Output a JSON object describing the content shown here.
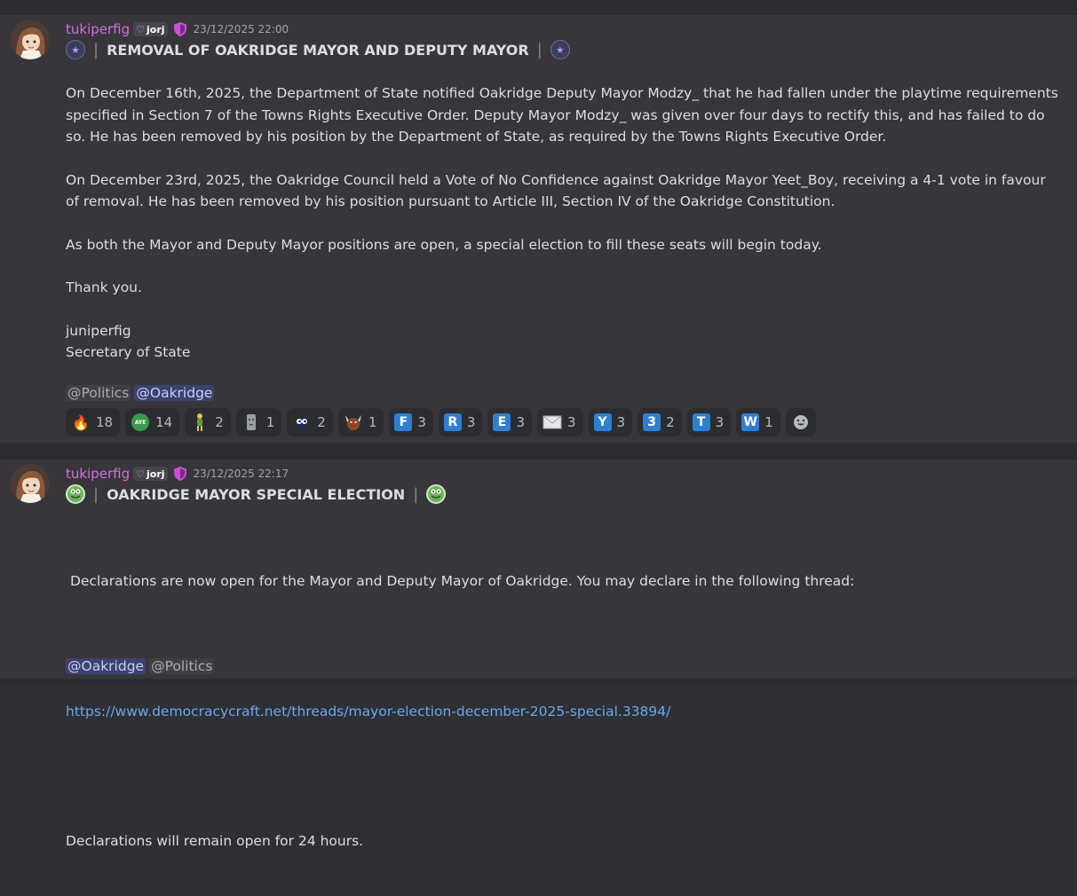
{
  "message1": {
    "username": "tukiperfig",
    "tag": "jorj",
    "timestamp": "23/12/2025 22:00",
    "title": "REMOVAL OF OAKRIDGE MAYOR AND DEPUTY MAYOR",
    "paragraphs": [
      "On December 16th, 2025, the Department of State notified Oakridge Deputy Mayor Modzy_ that he had fallen under the playtime requirements specified in Section 7 of the Towns Rights Executive Order. Deputy Mayor Modzy_ was given over four days to rectify this, and has failed to do so. He has been removed by his position by the Department of State, as required by the Towns Rights Executive Order.",
      "On December 23rd, 2025, the Oakridge Council held a Vote of No Confidence against Oakridge Mayor Yeet_Boy, receiving a 4-1 vote in favour of removal. He has been removed by his position pursuant to Article III, Section IV of the Oakridge Constitution.",
      "As both the Mayor and Deputy Mayor positions are open, a special election to fill these seats will begin today.",
      "Thank you."
    ],
    "signature_name": "juniperfig",
    "signature_title": "Secretary of State",
    "mentions": [
      "@Politics",
      "@Oakridge"
    ],
    "reactions": [
      {
        "emoji": "fire-icon",
        "label": "🔥",
        "count": "18"
      },
      {
        "emoji": "aye-icon",
        "label": "AYE",
        "count": "14"
      },
      {
        "emoji": "figure-icon",
        "label": "🚶",
        "count": "2"
      },
      {
        "emoji": "moai-icon",
        "label": "🗿",
        "count": "1"
      },
      {
        "emoji": "face-icon",
        "label": "👀",
        "count": "2"
      },
      {
        "emoji": "horns-icon",
        "label": "😈",
        "count": "1"
      },
      {
        "emoji": "letter-f",
        "label": "F",
        "count": "3"
      },
      {
        "emoji": "letter-r",
        "label": "R",
        "count": "3"
      },
      {
        "emoji": "letter-e",
        "label": "E",
        "count": "3"
      },
      {
        "emoji": "envelope-icon",
        "label": "✉",
        "count": "3"
      },
      {
        "emoji": "letter-y",
        "label": "Y",
        "count": "3"
      },
      {
        "emoji": "number-3",
        "label": "3",
        "count": "2"
      },
      {
        "emoji": "letter-t",
        "label": "T",
        "count": "3"
      },
      {
        "emoji": "letter-w",
        "label": "W",
        "count": "1"
      }
    ]
  },
  "message2": {
    "username": "tukiperfig",
    "tag": "jorj",
    "timestamp": "23/12/2025 22:17",
    "title": "OAKRIDGE MAYOR SPECIAL ELECTION",
    "paragraph1": " Declarations are now open for the Mayor and Deputy Mayor of Oakridge. You may declare in the following thread:",
    "link": "https://www.democracycraft.net/threads/mayor-election-december-2025-special.33894/",
    "paragraph2": "Declarations will remain open for 24 hours.",
    "mentions": [
      "@Oakridge",
      "@Politics"
    ]
  },
  "colors": {
    "username": "#d46ee0",
    "link": "#6ba7ec",
    "mention_highlight": "#3c4270",
    "background": "#38363a"
  }
}
